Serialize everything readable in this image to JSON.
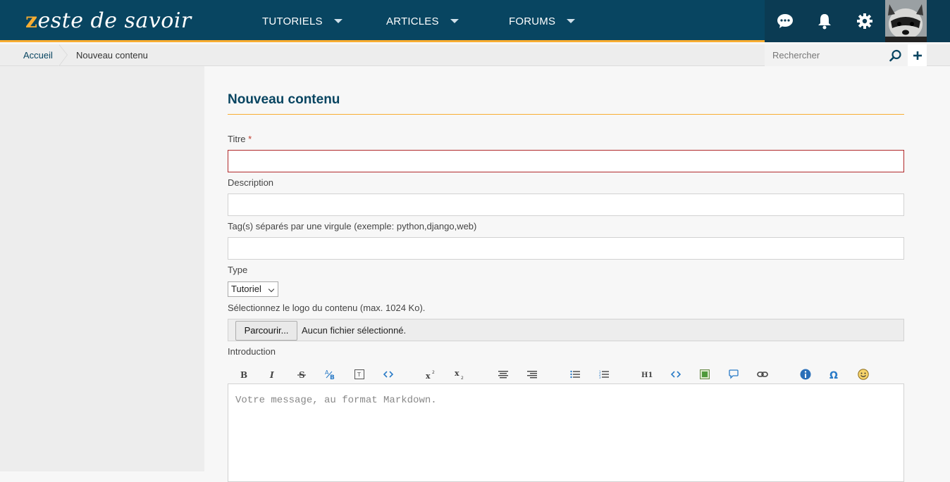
{
  "header": {
    "logo_text": "zeste de savoir",
    "nav": [
      {
        "label": "TUTORIELS"
      },
      {
        "label": "ARTICLES"
      },
      {
        "label": "FORUMS"
      }
    ],
    "icons": [
      "messages-icon",
      "bell-icon",
      "gear-icon"
    ]
  },
  "breadcrumb": {
    "home": "Accueil",
    "current": "Nouveau contenu"
  },
  "search": {
    "placeholder": "Rechercher"
  },
  "form": {
    "title": "Nouveau contenu",
    "titre_label": "Titre",
    "required_mark": "*",
    "titre_value": "",
    "description_label": "Description",
    "description_value": "",
    "tags_label": "Tag(s) séparés par une virgule (exemple: python,django,web)",
    "tags_value": "",
    "type_label": "Type",
    "type_selected": "Tutoriel",
    "logo_label": "Sélectionnez le logo du contenu (max. 1024 Ko).",
    "browse_label": "Parcourir...",
    "file_status": "Aucun fichier sélectionné.",
    "introduction_label": "Introduction",
    "editor_placeholder": "Votre message, au format Markdown."
  },
  "colors": {
    "header_bg": "#084561",
    "accent": "#f8ad32",
    "title": "#084561",
    "error_border": "#b0282a"
  }
}
